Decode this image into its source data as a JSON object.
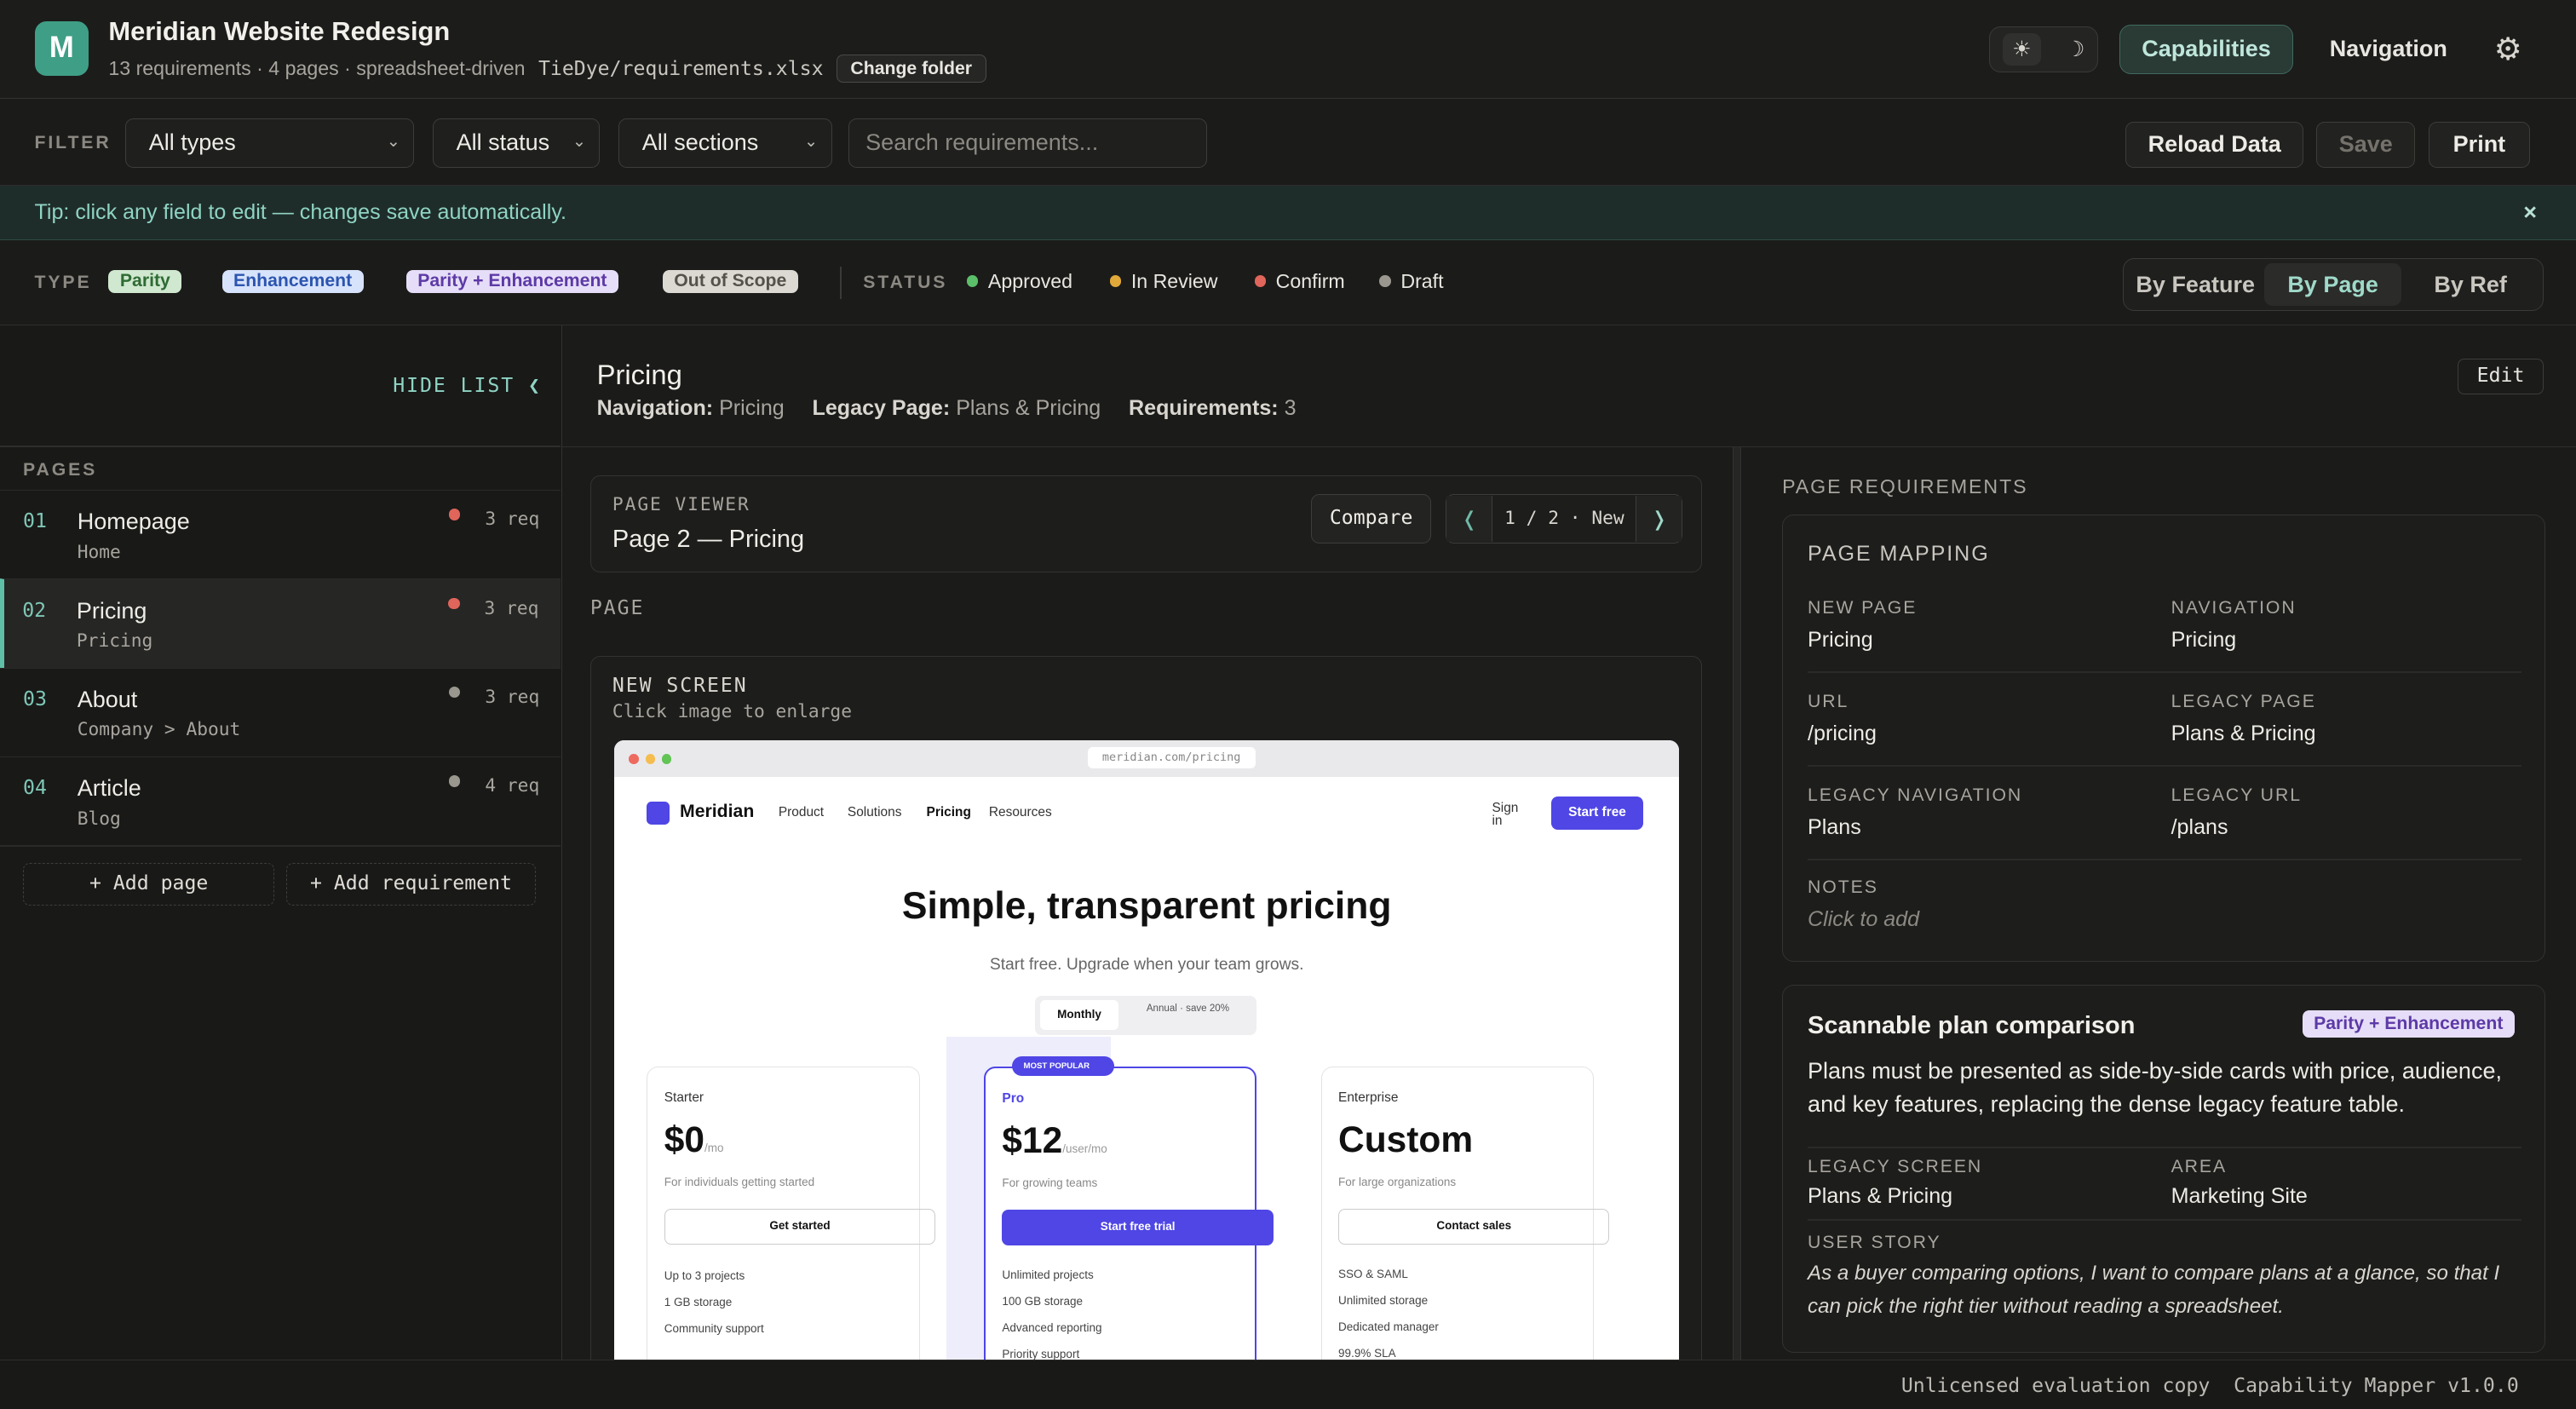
{
  "project": {
    "logo_letter": "M",
    "title": "Meridian Website Redesign",
    "meta": "13 requirements · 4 pages · spreadsheet-driven",
    "path": "TieDye/requirements.xlsx",
    "change_folder": "Change folder"
  },
  "header": {
    "theme_light": "☀",
    "theme_dark": "☽",
    "tabs": [
      "Capabilities",
      "Navigation"
    ],
    "active_tab": "Capabilities",
    "settings_icon": "⚙"
  },
  "filter": {
    "label": "FILTER",
    "type_select": "All types",
    "status_select": "All status",
    "section_select": "All sections",
    "search_placeholder": "Search requirements...",
    "reload": "Reload Data",
    "save": "Save",
    "print": "Print"
  },
  "tip": {
    "text": "Tip: click any field to edit — changes save automatically.",
    "close": "×"
  },
  "legend": {
    "type_label": "TYPE",
    "types": [
      "Parity",
      "Enhancement",
      "Parity + Enhancement",
      "Out of Scope"
    ],
    "status_label": "STATUS",
    "statuses": [
      {
        "label": "Approved",
        "color": "#5cbf6a"
      },
      {
        "label": "In Review",
        "color": "#e0a93a"
      },
      {
        "label": "Confirm",
        "color": "#e0655a"
      },
      {
        "label": "Draft",
        "color": "#9a978f"
      }
    ],
    "views": [
      "By Feature",
      "By Page",
      "By Ref"
    ],
    "active_view": "By Page"
  },
  "sidebar": {
    "hide_list": "HIDE LIST ❮",
    "pages_label": "PAGES",
    "pages": [
      {
        "num": "01",
        "name": "Homepage",
        "sub": "Home",
        "req": "3 req",
        "dot": "#e0655a"
      },
      {
        "num": "02",
        "name": "Pricing",
        "sub": "Pricing",
        "req": "3 req",
        "dot": "#e0655a"
      },
      {
        "num": "03",
        "name": "About",
        "sub": "Company > About",
        "req": "3 req",
        "dot": "#9a978f"
      },
      {
        "num": "04",
        "name": "Article",
        "sub": "Blog",
        "req": "4 req",
        "dot": "#9a978f"
      }
    ],
    "add_page": "+ Add page",
    "add_requirement": "+ Add requirement"
  },
  "main": {
    "title": "Pricing",
    "nav_key": "Navigation:",
    "nav_val": "Pricing",
    "legacy_key": "Legacy Page:",
    "legacy_val": "Plans & Pricing",
    "req_key": "Requirements:",
    "req_val": "3",
    "edit": "Edit"
  },
  "viewer": {
    "label": "PAGE VIEWER",
    "title": "Page 2 — Pricing",
    "compare": "Compare",
    "prev": "❬",
    "next": "❭",
    "position": "1 / 2 · New",
    "page_label": "PAGE",
    "screen_label": "NEW SCREEN",
    "screen_hint": "Click image to enlarge"
  },
  "mock": {
    "url": "meridian.com/pricing",
    "brand": "Meridian",
    "nav": [
      "Product",
      "Solutions",
      "Pricing",
      "Resources"
    ],
    "sign_in": "Sign in",
    "start_free": "Start free",
    "hero": "Simple, transparent pricing",
    "sub": "Start free. Upgrade when your team grows.",
    "monthly": "Monthly",
    "annual": "Annual · save 20%",
    "most_popular": "MOST POPULAR",
    "plans": [
      {
        "name": "Starter",
        "price": "$0",
        "unit": "/mo",
        "desc": "For individuals getting started",
        "cta": "Get started",
        "features": [
          "Up to 3 projects",
          "1 GB storage",
          "Community support"
        ]
      },
      {
        "name": "Pro",
        "price": "$12",
        "unit": "/user/mo",
        "desc": "For growing teams",
        "cta": "Start free trial",
        "features": [
          "Unlimited projects",
          "100 GB storage",
          "Advanced reporting",
          "Priority support"
        ]
      },
      {
        "name": "Enterprise",
        "price": "Custom",
        "unit": "",
        "desc": "For large organizations",
        "cta": "Contact sales",
        "features": [
          "SSO & SAML",
          "Unlimited storage",
          "Dedicated manager",
          "99.9% SLA"
        ]
      }
    ]
  },
  "requirements": {
    "label": "PAGE REQUIREMENTS",
    "mapping_title": "PAGE MAPPING",
    "fields": [
      {
        "k": "NEW PAGE",
        "v": "Pricing"
      },
      {
        "k": "NAVIGATION",
        "v": "Pricing"
      },
      {
        "k": "URL",
        "v": "/pricing"
      },
      {
        "k": "LEGACY PAGE",
        "v": "Plans & Pricing"
      },
      {
        "k": "LEGACY NAVIGATION",
        "v": "Plans"
      },
      {
        "k": "LEGACY URL",
        "v": "/plans"
      },
      {
        "k": "NOTES",
        "v": "Click to add"
      }
    ],
    "req": {
      "title": "Scannable plan comparison",
      "badge": "Parity + Enhancement",
      "desc": "Plans must be presented as side-by-side cards with price, audience, and key features, replacing the dense legacy feature table.",
      "legacy_screen_k": "LEGACY SCREEN",
      "legacy_screen_v": "Plans & Pricing",
      "area_k": "AREA",
      "area_v": "Marketing Site",
      "story_k": "USER STORY",
      "story_v": "As a buyer comparing options, I want to compare plans at a glance, so that I can pick the right tier without reading a spreadsheet."
    }
  },
  "footer": {
    "text": "Unlicensed evaluation copy  Capability Mapper v1.0.0"
  }
}
